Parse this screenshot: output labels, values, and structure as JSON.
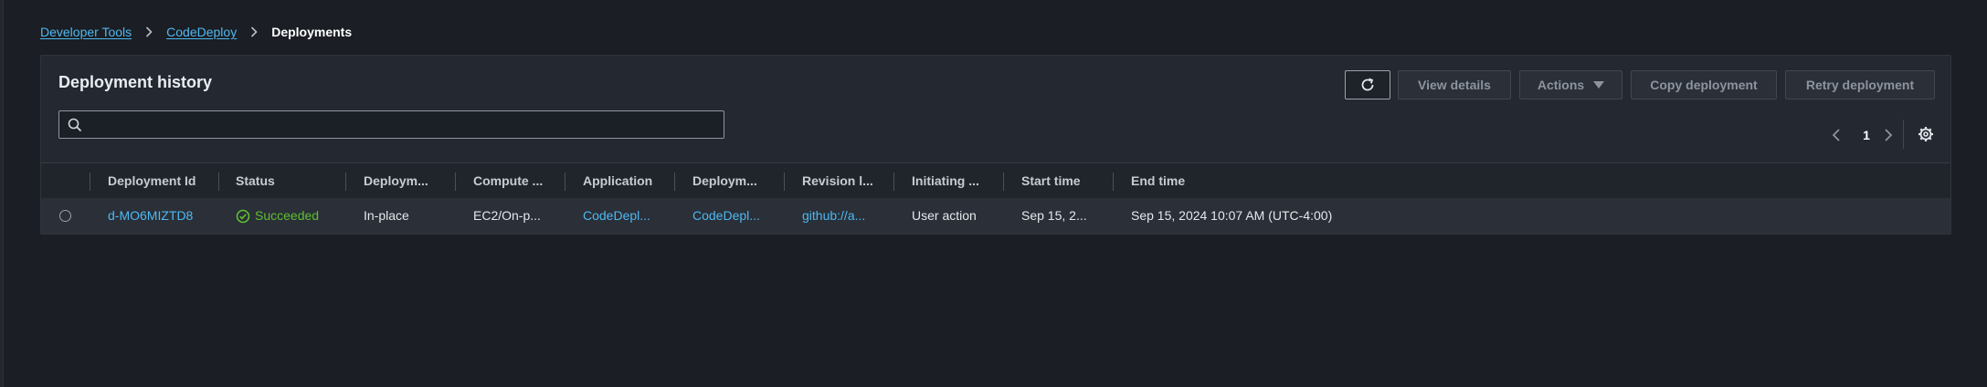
{
  "breadcrumb": {
    "items": [
      "Developer Tools",
      "CodeDeploy"
    ],
    "current": "Deployments"
  },
  "panel": {
    "title": "Deployment history",
    "search_placeholder": "",
    "buttons": {
      "view_details": "View details",
      "actions": "Actions",
      "copy_deployment": "Copy deployment",
      "retry_deployment": "Retry deployment"
    },
    "pagination": {
      "page": "1"
    }
  },
  "table": {
    "columns": [
      "Deployment Id",
      "Status",
      "Deploym...",
      "Compute ...",
      "Application",
      "Deploym...",
      "Revision l...",
      "Initiating ...",
      "Start time",
      "End time"
    ],
    "rows": [
      {
        "deployment_id": "d-MO6MIZTD8",
        "status": "Succeeded",
        "deployment_type": "In-place",
        "compute_platform": "EC2/On-p...",
        "application": "CodeDepl...",
        "deployment_group": "CodeDepl...",
        "revision_location": "github://a...",
        "initiating_event": "User action",
        "start_time": "Sep 15, 2...",
        "end_time": "Sep 15, 2024 10:07 AM (UTC-4:00)"
      }
    ]
  },
  "colors": {
    "background": "#1b1e24",
    "panel": "#232831",
    "link": "#4fb8ef",
    "success": "#5fbf2f"
  },
  "icons": [
    "chevron-right-icon",
    "refresh-icon",
    "caret-down-icon",
    "search-icon",
    "chevron-left-icon",
    "settings-gear-icon",
    "check-circle-icon"
  ]
}
